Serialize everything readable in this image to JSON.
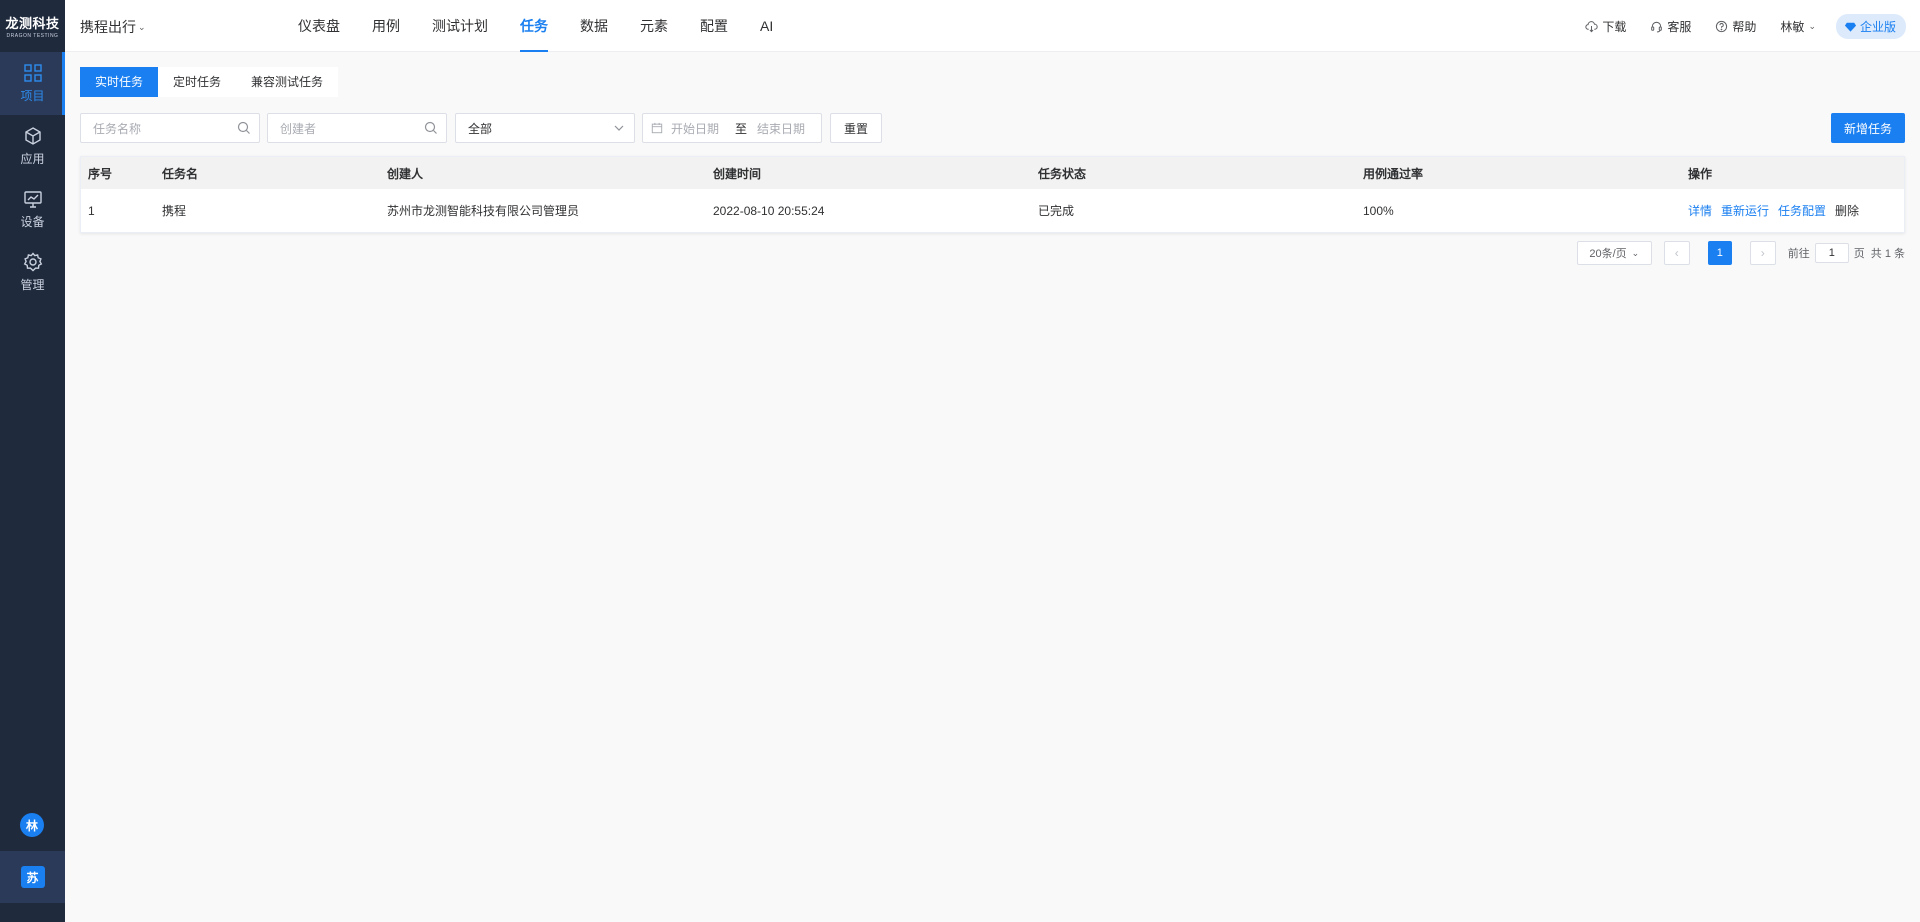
{
  "brand": {
    "name": "龙测科技",
    "sub": "DRAGON TESTING"
  },
  "sidebar": {
    "items": [
      {
        "label": "项目",
        "icon": "grid-icon"
      },
      {
        "label": "应用",
        "icon": "cube-icon"
      },
      {
        "label": "设备",
        "icon": "monitor-icon"
      },
      {
        "label": "管理",
        "icon": "gear-icon"
      }
    ],
    "user_avatar": "林",
    "org_avatar": "苏"
  },
  "header": {
    "project": "携程出行",
    "nav": [
      "仪表盘",
      "用例",
      "测试计划",
      "任务",
      "数据",
      "元素",
      "配置",
      "AI"
    ],
    "active_nav": "任务",
    "download": "下载",
    "service": "客服",
    "help": "帮助",
    "user": "林敏",
    "edition": "企业版"
  },
  "tabs": [
    "实时任务",
    "定时任务",
    "兼容测试任务"
  ],
  "filters": {
    "task_name_placeholder": "任务名称",
    "creator_placeholder": "创建者",
    "status_value": "全部",
    "start_date_placeholder": "开始日期",
    "date_sep": "至",
    "end_date_placeholder": "结束日期",
    "reset_label": "重置",
    "add_label": "新增任务"
  },
  "table": {
    "columns": [
      "序号",
      "任务名",
      "创建人",
      "创建时间",
      "任务状态",
      "用例通过率",
      "操作"
    ],
    "rows": [
      {
        "index": "1",
        "name": "携程",
        "creator": "苏州市龙测智能科技有限公司管理员",
        "created": "2022-08-10 20:55:24",
        "status": "已完成",
        "pass_rate": "100%",
        "ops": [
          "详情",
          "重新运行",
          "任务配置",
          "删除"
        ]
      }
    ]
  },
  "pagination": {
    "page_size": "20条/页",
    "current_page": "1",
    "goto_prefix": "前往",
    "goto_value": "1",
    "goto_suffix": "页",
    "total": "共 1 条"
  }
}
